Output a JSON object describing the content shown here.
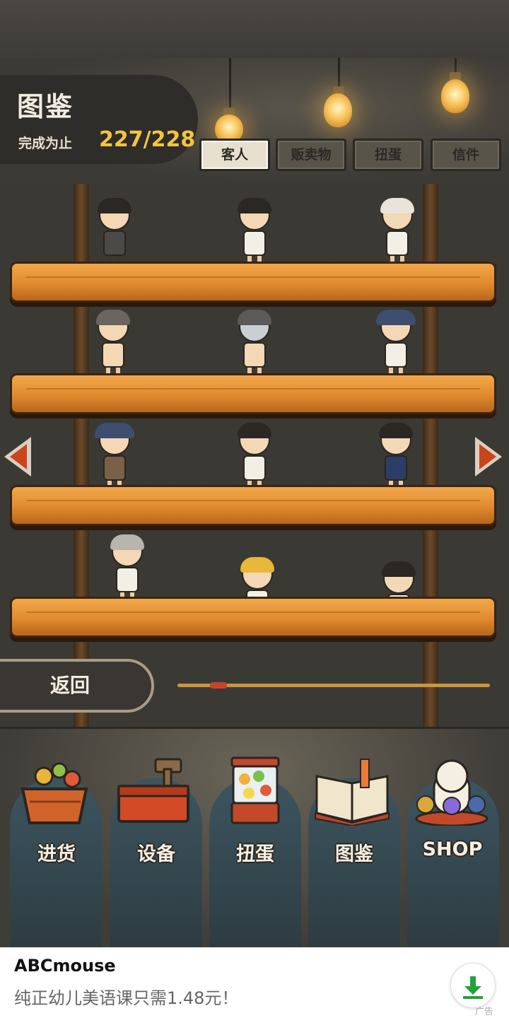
{
  "header": {
    "title": "图鉴",
    "progress_label": "完成为止",
    "progress_value": "227/228"
  },
  "tabs": [
    {
      "label": "客人",
      "active": true
    },
    {
      "label": "贩卖物",
      "active": false
    },
    {
      "label": "扭蛋",
      "active": false
    },
    {
      "label": "信件",
      "active": false
    }
  ],
  "back_label": "返回",
  "bottom_nav": [
    {
      "label": "进货",
      "icon": "crate-icon"
    },
    {
      "label": "设备",
      "icon": "toolbox-icon"
    },
    {
      "label": "扭蛋",
      "icon": "gacha-machine-icon"
    },
    {
      "label": "图鉴",
      "icon": "book-icon"
    },
    {
      "label": "SHOP",
      "icon": "lucky-cat-icon"
    }
  ],
  "ad": {
    "title": "ABCmouse",
    "description": "纯正幼儿美语课只需1.48元！",
    "tag": "广告"
  },
  "colors": {
    "accent_gold": "#f3c53f",
    "arrow_red": "#c9451c",
    "shelf_wood": "#e08a2e"
  }
}
